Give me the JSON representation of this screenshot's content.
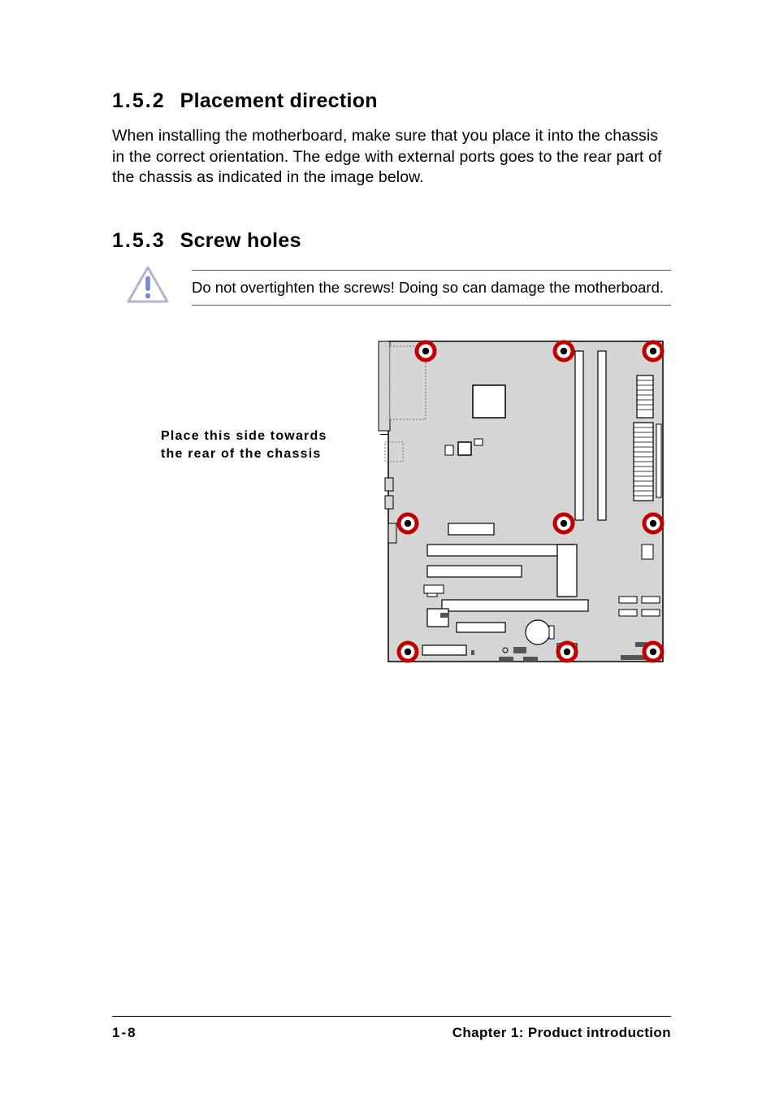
{
  "sections": {
    "s1": {
      "num": "1.5.2",
      "title": "Placement direction"
    },
    "s2": {
      "num": "1.5.3",
      "title": "Screw holes"
    }
  },
  "paragraphs": {
    "p1": "When installing the motherboard, make sure that you place it into the chassis in the correct orientation. The edge with external ports goes to the rear part of the chassis as indicated in the image below."
  },
  "callout": {
    "text": "Do not overtighten the screws! Doing so can damage the motherboard."
  },
  "figure": {
    "label_line1": "Place this side towards",
    "label_line2": "the rear of the chassis"
  },
  "footer": {
    "page": "1-8",
    "chapter": "Chapter 1: Product introduction"
  }
}
